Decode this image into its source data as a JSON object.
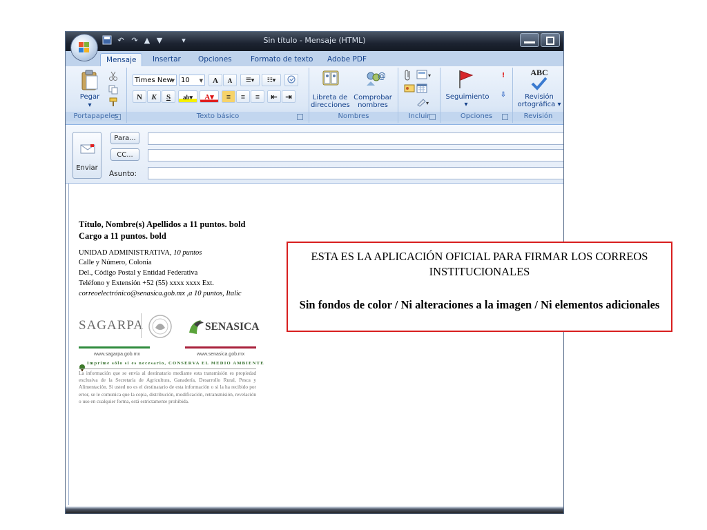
{
  "window": {
    "title": "Sin título - Mensaje (HTML)"
  },
  "ribbon_tabs": [
    "Mensaje",
    "Insertar",
    "Opciones",
    "Formato de texto",
    "Adobe PDF"
  ],
  "ribbon": {
    "clipboard": {
      "paste_label": "Pegar",
      "group_label": "Portapapeles"
    },
    "basic_text": {
      "font_name": "Times New",
      "font_size": "10",
      "grow_label": "A",
      "shrink_label": "A",
      "bold_label": "N",
      "italic_label": "K",
      "underline_label": "S",
      "font_color_label": "A",
      "highlight_label": "ab",
      "group_label": "Texto básico"
    },
    "names": {
      "address_book_line1": "Libreta de",
      "address_book_line2": "direcciones",
      "check_names_line1": "Comprobar",
      "check_names_line2": "nombres",
      "group_label": "Nombres"
    },
    "include": {
      "group_label": "Incluir"
    },
    "options": {
      "followup_label": "Seguimiento",
      "group_label": "Opciones"
    },
    "proofing": {
      "abc": "ABC",
      "spelling_line1": "Revisión",
      "spelling_line2": "ortográfica",
      "group_label": "Revisión"
    }
  },
  "message_header": {
    "send_label": "Enviar",
    "to_label": "Para...",
    "cc_label": "CC...",
    "subject_label": "Asunto:",
    "to_value": "",
    "cc_value": "",
    "subject_value": ""
  },
  "signature": {
    "line1": "Título, Nombre(s) Apellidos a 11 puntos. bold",
    "line2": "Cargo a 11 puntos. bold",
    "unit_main": "UNIDAD ADMINISTRATIVA,",
    "unit_italic": " 10 puntos",
    "street": "Calle y Número, Colonia",
    "city": "Del., Código Postal y Entidad Federativa",
    "phone": "Teléfono y Extensión +52 (55) xxxx xxxx Ext.",
    "email_italic": "correoelectrónico@senasica.gob.mx ,a 10 puntos, Italic",
    "logo_left_text": "SAGARPA",
    "logo_right_text": "SENASICA",
    "url_left": "www.sagarpa.gob.mx",
    "url_right": "www.senasica.gob.mx",
    "print_notice": "Imprime sólo si es necesario, CONSERVA EL MEDIO AMBIENTE",
    "legal": "La información que se envía al destinatario mediante esta transmisión es propiedad exclusiva de la Secretaría de Agricultura, Ganadería, Desarrollo Rural, Pesca y Alimentación. Si usted no es el destinatario de esta información o si la ha recibido por error, se le comunica que la copia, distribución, modificación, retransmisión, revelación o uso en cualquier forma, está estrictamente prohibida."
  },
  "notice": {
    "line1": "ESTA  ES LA APLICACIÓN OFICIAL PARA FIRMAR LOS CORREOS INSTITUCIONALES",
    "line2": "Sin fondos de color / Ni alteraciones a la imagen / Ni elementos adicionales",
    "border_color": "#d81e1e"
  },
  "colors": {
    "sagarpa_green": "#2e8b3c",
    "senasica_red": "#a8203a",
    "ribbon_text": "#15428b"
  }
}
